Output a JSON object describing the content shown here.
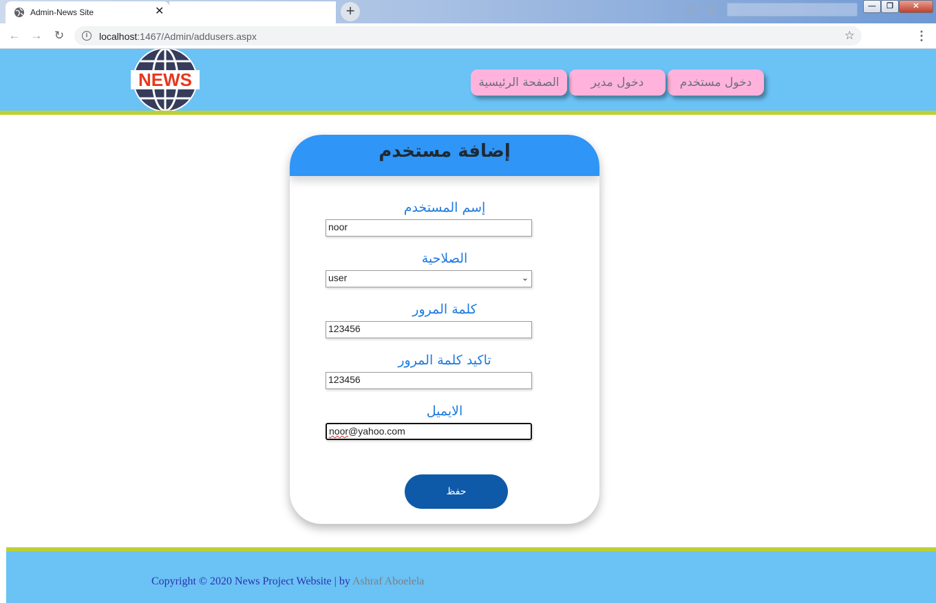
{
  "browser": {
    "tab_title": "Admin-News Site",
    "tab_close": "✕",
    "new_tab": "+",
    "url_host": "localhost",
    "url_path": ":1467/Admin/addusers.aspx",
    "window_controls": {
      "minimize": "—",
      "maximize": "❐",
      "close": "✕"
    }
  },
  "header": {
    "logo_text": "NEWS",
    "nav": [
      {
        "label": "دخول مستخدم"
      },
      {
        "label": "دخول مدير"
      },
      {
        "label": "الصفحة الرئيسية"
      }
    ],
    "colors": {
      "background": "#6ac2f5",
      "accent_border": "#bcd034",
      "nav_pill": "#ffb3dc"
    }
  },
  "form": {
    "title": "إضافة مستخدم",
    "fields": [
      {
        "label": "إسم المستخدم",
        "value": "noor"
      },
      {
        "label": "الصلاحية",
        "value": "user"
      },
      {
        "label": "كلمة المرور",
        "value": "123456"
      },
      {
        "label": "تاكيد كلمة المرور",
        "value": "123456"
      },
      {
        "label": "الايميل",
        "value": "noor@yahoo.com",
        "value_prefix": "noor",
        "value_suffix": "@yahoo.com"
      }
    ],
    "save_label": "حفظ",
    "colors": {
      "header": "#2f95f6",
      "label": "#1c7ae0",
      "button": "#0f5aa8"
    }
  },
  "footer": {
    "copyright": "Copyright © 2020 News Project Website | by ",
    "author": "Ashraf Aboelela"
  }
}
